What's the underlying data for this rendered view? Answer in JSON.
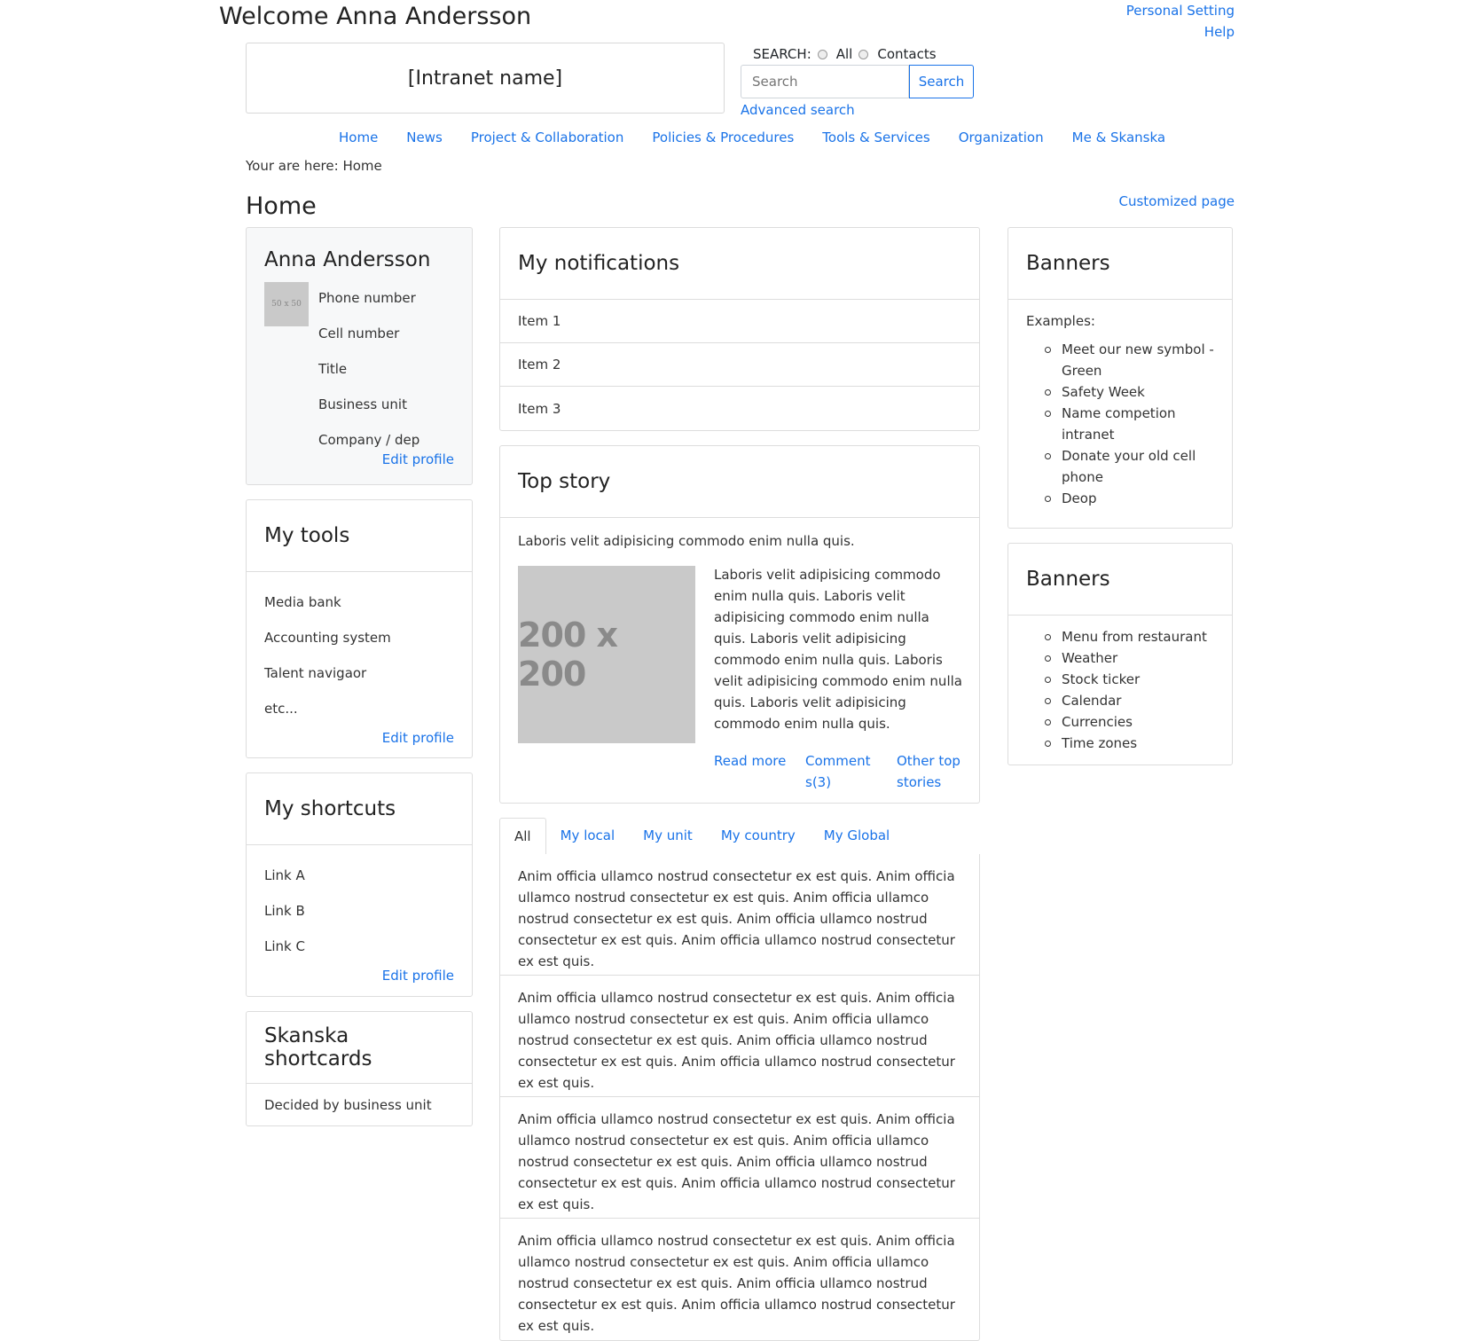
{
  "header": {
    "welcome": "Welcome Anna Andersson",
    "personal_setting": "Personal Setting",
    "help": "Help",
    "intranet_name": "[Intranet name]"
  },
  "search": {
    "label": "SEARCH:",
    "option_all": "All",
    "option_contacts": "Contacts",
    "placeholder": "Search",
    "button": "Search",
    "advanced": "Advanced search"
  },
  "nav": {
    "items": [
      "Home",
      "News",
      "Project & Collaboration",
      "Policies & Procedures",
      "Tools & Services",
      "Organization",
      "Me & Skanska"
    ]
  },
  "breadcrumb": "Your are here: Home",
  "page": {
    "title": "Home",
    "customized": "Customized page"
  },
  "profile": {
    "name": "Anna Andersson",
    "avatar_text": "50 x 50",
    "fields": [
      "Phone number",
      "Cell number",
      "Title",
      "Business unit",
      "Company / dep"
    ],
    "edit": "Edit profile"
  },
  "tools": {
    "title": "My tools",
    "items": [
      "Media bank",
      "Accounting system",
      "Talent navigaor",
      "etc..."
    ],
    "edit": "Edit profile"
  },
  "shortcuts": {
    "title": "My shortcuts",
    "items": [
      "Link A",
      "Link B",
      "Link C"
    ],
    "edit": "Edit profile"
  },
  "skanska": {
    "title": "Skanska shortcards",
    "text": "Decided by business unit"
  },
  "notifications": {
    "title": "My notifications",
    "items": [
      "Item 1",
      "Item 2",
      "Item 3"
    ]
  },
  "topstory": {
    "title": "Top story",
    "lead": "Laboris velit adipisicing commodo enim nulla quis.",
    "image_text": "200 x 200",
    "body": "Laboris velit adipisicing commodo enim nulla quis. Laboris velit adipisicing commodo enim nulla quis. Laboris velit adipisicing commodo enim nulla quis. Laboris velit adipisicing commodo enim nulla quis. Laboris velit adipisicing commodo enim nulla quis.",
    "read_more": "Read more",
    "comments": "Comment s(3)",
    "other": "Other top stories"
  },
  "tabs": [
    "All",
    "My local",
    "My unit",
    "My country",
    "My Global"
  ],
  "feed": [
    "Anim officia ullamco nostrud consectetur ex est quis. Anim officia ullamco nostrud consectetur ex est quis. Anim officia ullamco nostrud consectetur ex est quis. Anim officia ullamco nostrud consectetur ex est quis. Anim officia ullamco nostrud consectetur ex est quis.",
    "Anim officia ullamco nostrud consectetur ex est quis. Anim officia ullamco nostrud consectetur ex est quis. Anim officia ullamco nostrud consectetur ex est quis. Anim officia ullamco nostrud consectetur ex est quis. Anim officia ullamco nostrud consectetur ex est quis.",
    "Anim officia ullamco nostrud consectetur ex est quis. Anim officia ullamco nostrud consectetur ex est quis. Anim officia ullamco nostrud consectetur ex est quis. Anim officia ullamco nostrud consectetur ex est quis. Anim officia ullamco nostrud consectetur ex est quis.",
    "Anim officia ullamco nostrud consectetur ex est quis. Anim officia ullamco nostrud consectetur ex est quis. Anim officia ullamco nostrud consectetur ex est quis. Anim officia ullamco nostrud consectetur ex est quis. Anim officia ullamco nostrud consectetur ex est quis."
  ],
  "banners1": {
    "title": "Banners",
    "intro": "Examples:",
    "items": [
      "Meet our new symbol - Green",
      "Safety Week",
      "Name competion intranet",
      "Donate your old cell phone",
      "Deop"
    ]
  },
  "banners2": {
    "title": "Banners",
    "items": [
      "Menu from restaurant",
      "Weather",
      "Stock ticker",
      "Calendar",
      "Currencies",
      "Time zones"
    ]
  },
  "colors": {
    "link": "#1a73e8",
    "border": "#dddddd",
    "profile_bg": "#f7f8f9",
    "placeholder_bg": "#c9c9c9"
  }
}
